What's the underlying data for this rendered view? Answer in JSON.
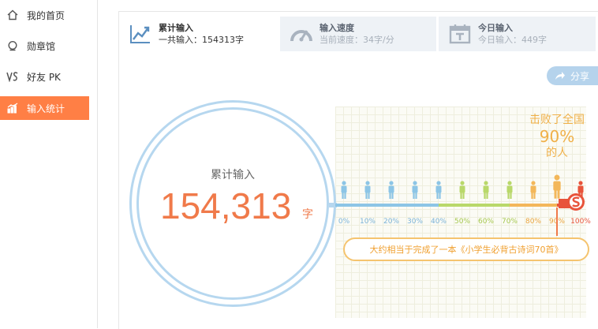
{
  "sidebar": {
    "items": [
      {
        "label": "我的首页",
        "icon": "home-icon",
        "active": false
      },
      {
        "label": "勋章馆",
        "icon": "medal-icon",
        "active": false
      },
      {
        "label": "好友 PK",
        "icon": "versus-icon",
        "active": false
      },
      {
        "label": "输入统计",
        "icon": "chart-icon",
        "active": true
      }
    ]
  },
  "tabs": [
    {
      "title": "累计输入",
      "subtitle": "一共输入：154313字",
      "icon": "trend-chart-icon",
      "active": true
    },
    {
      "title": "输入速度",
      "subtitle": "当前速度：34字/分",
      "icon": "speedometer-icon",
      "active": false
    },
    {
      "title": "今日输入",
      "subtitle": "今日输入：449字",
      "icon": "calendar-icon",
      "active": false
    }
  ],
  "share": {
    "label": "分享",
    "icon": "share-arrow-icon"
  },
  "total": {
    "label": "累计输入",
    "value": "154,313",
    "unit": "字"
  },
  "scale": {
    "percent_labels": [
      "0%",
      "10%",
      "20%",
      "30%",
      "40%",
      "50%",
      "60%",
      "70%",
      "80%",
      "90%",
      "100%"
    ],
    "current_percent": 90
  },
  "defeat": {
    "line1": "击败了全国",
    "percent": "90%",
    "line3": "的人"
  },
  "achievement": {
    "text": "大约相当于完成了一本《小学生必背古诗词70首》"
  },
  "colors": {
    "accent": "#ff7f45",
    "number": "#f07a4a",
    "ring": "#b6d7ef",
    "blue_segment": "#8cc5e6",
    "green_segment": "#b9d86a",
    "orange_segment": "#f3b75a",
    "red_segment": "#e8543b"
  }
}
